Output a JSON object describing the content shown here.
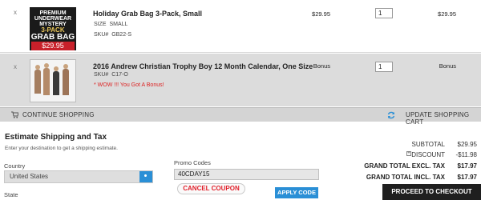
{
  "cart": {
    "items": [
      {
        "remove_label": "x",
        "thumb": {
          "line1": "PREMIUM",
          "line2": "UNDERWEAR",
          "line3": "MYSTERY",
          "line4": "3-PACK",
          "line5": "GRAB BAG",
          "price": "$29.95"
        },
        "title": "Holiday Grab Bag 3-Pack, Small",
        "size_label": "SIZE",
        "size_value": "SMALL",
        "sku_label": "SKU#",
        "sku_value": "GB22-S",
        "unit_price": "$29.95",
        "quantity": "1",
        "subtotal": "$29.95"
      },
      {
        "remove_label": "x",
        "title": "2016 Andrew Christian Trophy Boy 12 Month Calendar, One Size",
        "sku_label": "SKU#",
        "sku_value": "C17-O",
        "bonus_message": "* WOW !!! You Got A Bonus!",
        "unit_price": "Bonus",
        "quantity": "1",
        "subtotal": "Bonus"
      }
    ],
    "continue_label": "CONTINUE SHOPPING",
    "update_label": "UPDATE SHOPPING CART"
  },
  "shipping": {
    "title": "Estimate Shipping and Tax",
    "hint": "Enter your destination to get a shipping estimate.",
    "country_label": "Country",
    "country_value": "United States",
    "state_label": "State"
  },
  "promo": {
    "label": "Promo Codes",
    "value": "40CDAY15",
    "cancel_label": "CANCEL COUPON",
    "apply_label": "APPLY CODE"
  },
  "totals": {
    "subtotal_label": "SUBTOTAL",
    "subtotal_value": "$29.95",
    "discount_label": "DISCOUNT",
    "discount_value": "-$11.98",
    "excl_label": "GRAND TOTAL EXCL. TAX",
    "excl_value": "$17.97",
    "incl_label": "GRAND TOTAL INCL. TAX",
    "incl_value": "$17.97",
    "checkout_label": "PROCEED TO CHECKOUT"
  },
  "colors": {
    "accent_blue": "#2a8fd6",
    "row_grey": "#dcdcdc",
    "bonus_red": "#dd2222",
    "checkout_black": "#1f1f1f"
  }
}
